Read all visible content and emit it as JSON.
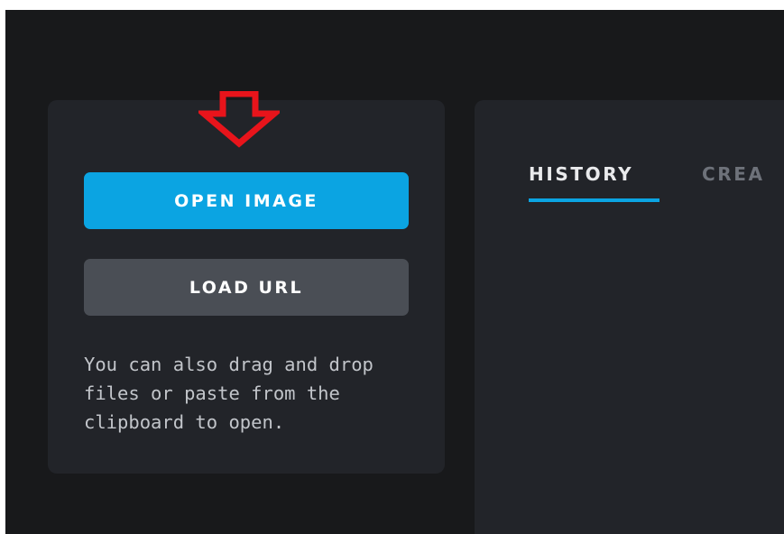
{
  "open_panel": {
    "open_image_label": "OPEN IMAGE",
    "load_url_label": "LOAD URL",
    "hint_text": "You can also drag and drop files or paste from the clipboard to open."
  },
  "tabs": [
    {
      "label": "HISTORY",
      "active": true
    },
    {
      "label": "CREA",
      "active": false
    }
  ],
  "colors": {
    "background": "#18191b",
    "panel": "#222429",
    "accent": "#0ba4e2",
    "secondary_button": "#4a4e55",
    "annotation_arrow": "#e8141b"
  },
  "icons": {
    "annotation": "down-arrow-icon"
  }
}
